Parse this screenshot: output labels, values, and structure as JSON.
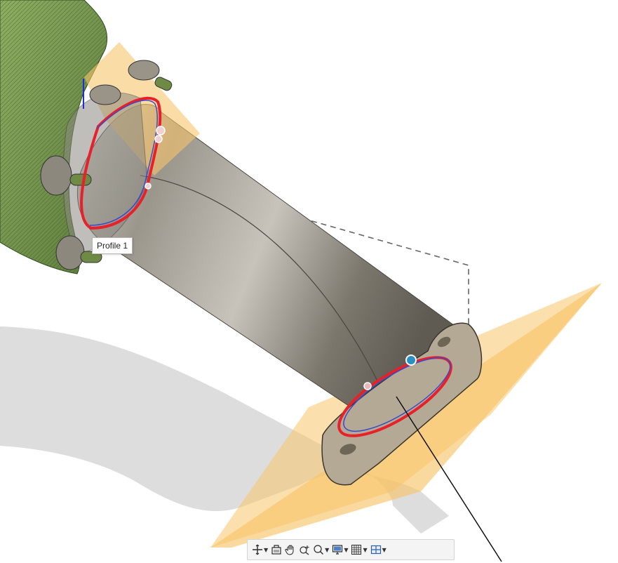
{
  "viewport": {
    "sketch_profile_tooltip": "Profile 1"
  },
  "colors": {
    "background": "#ffffff",
    "pipe_body": "#8f8a80",
    "housing_mesh": "#7d9a57",
    "construction_plane": "#f7c46a",
    "profile_outline": "#e8202a",
    "profile_inner": "#3a49c9",
    "flange": "#b3a994"
  },
  "nav_toolbar": {
    "items": [
      {
        "icon": "orbit-icon",
        "dropdown": true
      },
      {
        "icon": "look-at-icon",
        "dropdown": false
      },
      {
        "icon": "pan-icon",
        "dropdown": false
      },
      {
        "icon": "zoom-icon",
        "dropdown": false
      },
      {
        "icon": "fit-icon",
        "dropdown": true
      },
      {
        "icon": "display-settings-icon",
        "dropdown": true
      },
      {
        "icon": "grid-snaps-icon",
        "dropdown": true
      },
      {
        "icon": "viewports-icon",
        "dropdown": true
      }
    ]
  }
}
